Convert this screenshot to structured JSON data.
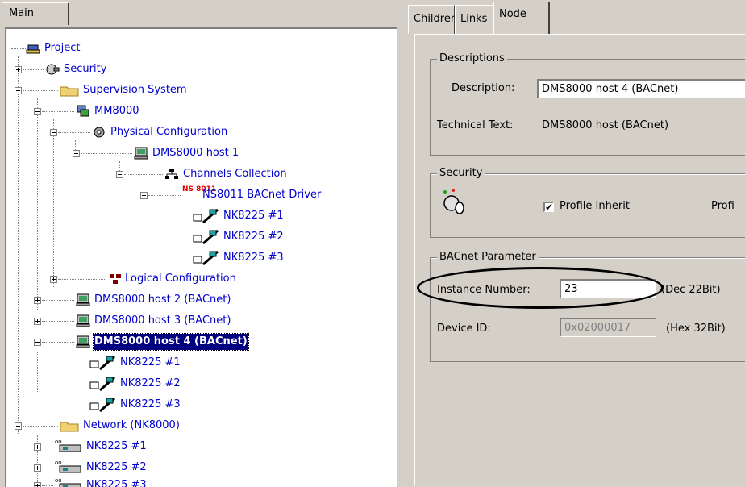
{
  "left_panel": {
    "tab_label": "Main",
    "tree": [
      {
        "label": "Project",
        "icon": "project-icon"
      },
      {
        "label": "Security",
        "icon": "security-icon"
      },
      {
        "label": "Supervision System",
        "icon": "folder-icon"
      },
      {
        "label": "MM8000",
        "icon": "mm8000-icon"
      },
      {
        "label": "Physical Configuration",
        "icon": "physical-config-icon"
      },
      {
        "label": "DMS8000 host 1",
        "icon": "computer-icon"
      },
      {
        "label": "Channels Collection",
        "icon": "channels-icon"
      },
      {
        "label": "NS8011 BACnet Driver",
        "icon": "ns8011-icon",
        "icon_text": "NS 8011"
      },
      {
        "label": "NK8225 #1",
        "icon": "nk-device-icon"
      },
      {
        "label": "NK8225 #2",
        "icon": "nk-device-icon"
      },
      {
        "label": "NK8225 #3",
        "icon": "nk-device-icon"
      },
      {
        "label": "Logical Configuration",
        "icon": "logical-config-icon"
      },
      {
        "label": "DMS8000 host 2 (BACnet)",
        "icon": "computer-icon"
      },
      {
        "label": "DMS8000 host 3 (BACnet)",
        "icon": "computer-icon"
      },
      {
        "label": "DMS8000 host 4 (BACnet)",
        "icon": "computer-icon",
        "selected": true
      },
      {
        "label": "NK8225 #1",
        "icon": "nk-device-icon"
      },
      {
        "label": "NK8225 #2",
        "icon": "nk-device-icon"
      },
      {
        "label": "NK8225 #3",
        "icon": "nk-device-icon"
      },
      {
        "label": "Network (NK8000)",
        "icon": "folder-icon"
      },
      {
        "label": "NK8225 #1",
        "icon": "network-device-icon"
      },
      {
        "label": "NK8225 #2",
        "icon": "network-device-icon"
      },
      {
        "label": "NK8225 #3",
        "icon": "network-device-icon"
      }
    ]
  },
  "right_panel": {
    "tabs": [
      {
        "label": "Children"
      },
      {
        "label": "Links"
      },
      {
        "label": "Node",
        "active": true
      }
    ],
    "descriptions": {
      "title": "Descriptions",
      "description_label": "Description:",
      "description_value": "DMS8000 host 4 (BACnet)",
      "technical_label": "Technical Text:",
      "technical_value": "DMS8000 host (BACnet)"
    },
    "security": {
      "title": "Security",
      "profile_inherit_label": "Profile Inherit",
      "profile_inherit_checked": "✔",
      "profile_label": "Profi"
    },
    "bacnet": {
      "title": "BACnet Parameter",
      "instance_label": "Instance Number:",
      "instance_value": "23",
      "instance_hint": "(Dec 22Bit)",
      "device_label": "Device ID:",
      "device_value": "0x02000017",
      "device_hint": "(Hex 32Bit)"
    }
  },
  "colors": {
    "window_bg": "#d4d0c8",
    "tree_text": "#0000cc",
    "selection_bg": "#000080"
  }
}
